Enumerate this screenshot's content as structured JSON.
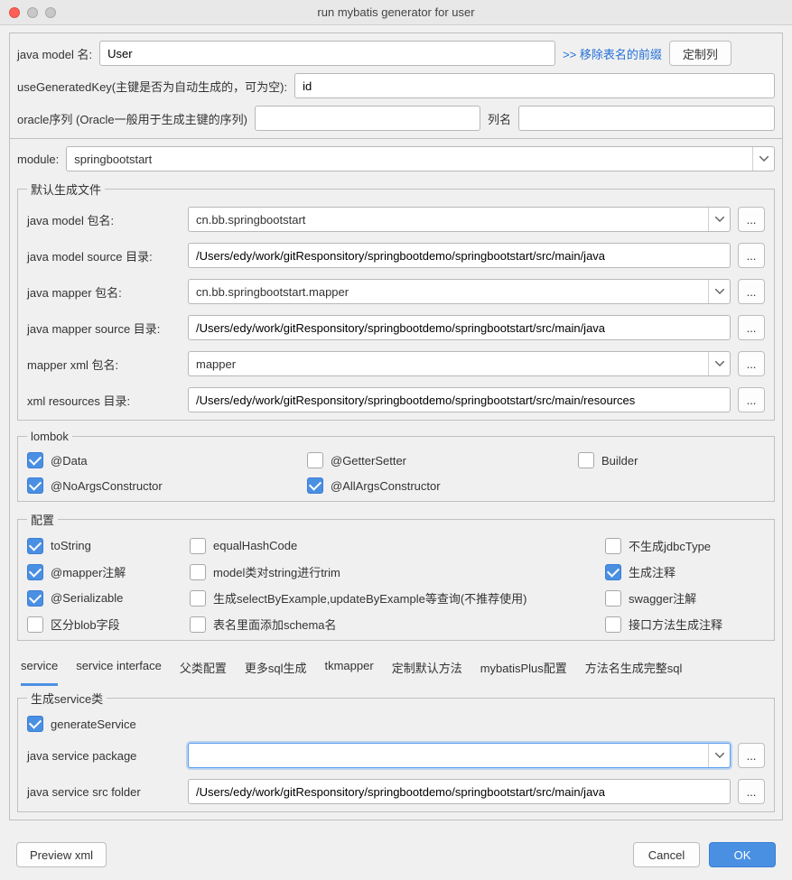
{
  "window": {
    "title": "run mybatis generator for user"
  },
  "top": {
    "javaModelNameLabel": "java model 名:",
    "javaModelNameValue": "User",
    "removePrefixLink": ">> 移除表名的前缀",
    "customColumnBtn": "定制列",
    "useGeneratedKeyLabel": "useGeneratedKey(主键是否为自动生成的，可为空):",
    "useGeneratedKeyValue": "id",
    "oracleSeqLabel": "oracle序列 (Oracle一般用于生成主键的序列)",
    "oracleSeqValue": "",
    "columnNameLabel": "列名",
    "columnNameValue": ""
  },
  "module": {
    "label": "module:",
    "value": "springbootstart"
  },
  "defaultGen": {
    "legend": "默认生成文件",
    "rows": {
      "javaModelPkgLabel": "java model 包名:",
      "javaModelPkgValue": "cn.bb.springbootstart",
      "javaModelSrcLabel": "java model source 目录:",
      "javaModelSrcValue": "/Users/edy/work/gitResponsitory/springbootdemo/springbootstart/src/main/java",
      "javaMapperPkgLabel": "java mapper 包名:",
      "javaMapperPkgValue": "cn.bb.springbootstart.mapper",
      "javaMapperSrcLabel": "java mapper source 目录:",
      "javaMapperSrcValue": "/Users/edy/work/gitResponsitory/springbootdemo/springbootstart/src/main/java",
      "mapperXmlPkgLabel": "mapper xml 包名:",
      "mapperXmlPkgValue": "mapper",
      "xmlResLabel": "xml resources 目录:",
      "xmlResValue": "/Users/edy/work/gitResponsitory/springbootdemo/springbootstart/src/main/resources"
    }
  },
  "lombok": {
    "legend": "lombok",
    "data": "@Data",
    "getterSetter": "@GetterSetter",
    "builder": "Builder",
    "noArgs": "@NoArgsConstructor",
    "allArgs": "@AllArgsConstructor"
  },
  "config": {
    "legend": "配置",
    "toString": "toString",
    "equalHashCode": "equalHashCode",
    "noJdbcType": "不生成jdbcType",
    "mapperAnno": "@mapper注解",
    "modelStringTrim": "model类对string进行trim",
    "genComment": "生成注释",
    "serializable": "@Serializable",
    "genSelectByExample": "生成selectByExample,updateByExample等查询(不推荐使用)",
    "swagger": "swagger注解",
    "blobField": "区分blob字段",
    "tableAddSchema": "表名里面添加schema名",
    "interfaceMethodComment": "接口方法生成注释"
  },
  "tabs": {
    "service": "service",
    "serviceInterface": "service interface",
    "parentConfig": "父类配置",
    "moreSql": "更多sql生成",
    "tkmapper": "tkmapper",
    "customDefault": "定制默认方法",
    "mybatisPlus": "mybatisPlus配置",
    "methodFullSql": "方法名生成完整sql"
  },
  "service": {
    "legend": "生成service类",
    "generateService": "generateService",
    "pkgLabel": "java service package",
    "pkgValue": "",
    "srcLabel": "java service src folder",
    "srcValue": "/Users/edy/work/gitResponsitory/springbootdemo/springbootstart/src/main/java"
  },
  "footer": {
    "previewXml": "Preview xml",
    "cancel": "Cancel",
    "ok": "OK"
  },
  "icons": {
    "ellipsis": "..."
  }
}
